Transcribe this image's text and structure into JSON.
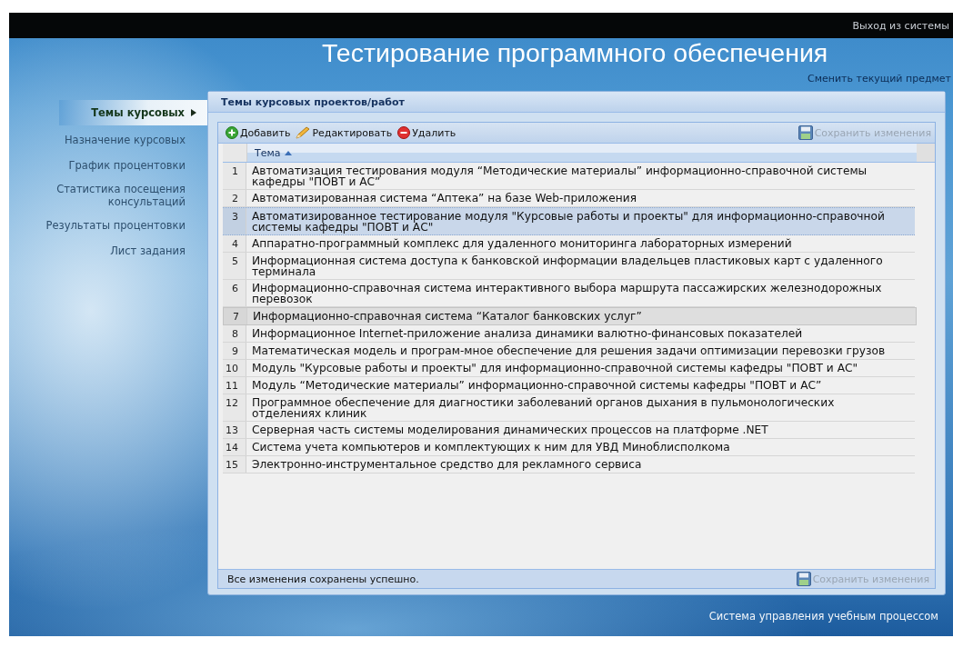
{
  "top_bar": {
    "logout_link": "Выход из системы"
  },
  "header": {
    "title": "Тестирование программного обеспечения",
    "change_subject_link": "Сменить текущий предмет"
  },
  "sidebar": {
    "items": [
      {
        "label": "Темы курсовых",
        "selected": true
      },
      {
        "label": "Назначение курсовых",
        "selected": false
      },
      {
        "label": "График процентовки",
        "selected": false
      },
      {
        "label": "Статистика посещения консультаций",
        "selected": false
      },
      {
        "label": "Результаты процентовки",
        "selected": false
      },
      {
        "label": "Лист задания",
        "selected": false
      }
    ]
  },
  "panel": {
    "title": "Темы курсовых проектов/работ",
    "toolbar": {
      "buttons": [
        {
          "kind": "add",
          "label": "Добавить"
        },
        {
          "kind": "edit",
          "label": "Редактировать"
        },
        {
          "kind": "delete",
          "label": "Удалить"
        }
      ],
      "save_button": {
        "label": "Сохранить изменения",
        "disabled": true
      }
    },
    "table": {
      "columns": [
        {
          "label": "Тема",
          "sort_ascending": true
        }
      ],
      "rows": [
        {
          "number": "1",
          "topic": "Автоматизация тестирования модуля “Методические материалы” информационно-справочной системы кафедры \"ПОВТ и АС”",
          "selected": false,
          "hovered": false
        },
        {
          "number": "2",
          "topic": "Автоматизированная система “Аптека” на базе Web-приложения",
          "selected": false,
          "hovered": false
        },
        {
          "number": "3",
          "topic": "Автоматизированное тестирование модуля \"Курсовые работы и проекты\" для информационно-справочной системы кафедры \"ПОВТ и АС\"",
          "selected": true,
          "hovered": false
        },
        {
          "number": "4",
          "topic": "Аппаратно-программный комплекс для удаленного мониторинга лабораторных измерений",
          "selected": false,
          "hovered": false
        },
        {
          "number": "5",
          "topic": "Информационная система доступа к банковской информации владельцев пластиковых карт с удаленного терминала",
          "selected": false,
          "hovered": false
        },
        {
          "number": "6",
          "topic": "Информационно-справочная система интерактивного выбора маршрута пассажирских железнодорожных перевозок",
          "selected": false,
          "hovered": false
        },
        {
          "number": "7",
          "topic": "Информационно-справочная система “Каталог банковских услуг”",
          "selected": false,
          "hovered": true
        },
        {
          "number": "8",
          "topic": "Информационное Internet-приложение анализа динамики валютно-финансовых показателей",
          "selected": false,
          "hovered": false
        },
        {
          "number": "9",
          "topic": "Математическая модель и програм-мное обеспечение для решения задачи оптимизации перевозки грузов",
          "selected": false,
          "hovered": false
        },
        {
          "number": "10",
          "topic": "Модуль \"Курсовые работы и проекты\" для информационно-справочной системы кафедры \"ПОВТ и АС\"",
          "selected": false,
          "hovered": false
        },
        {
          "number": "11",
          "topic": "Модуль “Методические материалы” информационно-справочной системы кафедры \"ПОВТ и АС”",
          "selected": false,
          "hovered": false
        },
        {
          "number": "12",
          "topic": "Программное обеспечение для диагностики заболеваний органов дыхания в пульмонологических отделениях клиник",
          "selected": false,
          "hovered": false
        },
        {
          "number": "13",
          "topic": "Серверная часть системы моделирования динамических процессов на платформе .NET",
          "selected": false,
          "hovered": false
        },
        {
          "number": "14",
          "topic": "Система учета компьютеров и комплектующих к ним для УВД Миноблисполкома",
          "selected": false,
          "hovered": false
        },
        {
          "number": "15",
          "topic": "Электронно-инструментальное средство для рекламного сервиса",
          "selected": false,
          "hovered": false
        }
      ]
    },
    "status_bar": {
      "message": "Все изменения сохранены успешно.",
      "save_button": {
        "label": "Сохранить изменения",
        "disabled": true
      }
    }
  },
  "footer": {
    "text": "Система управления учебным процессом"
  }
}
